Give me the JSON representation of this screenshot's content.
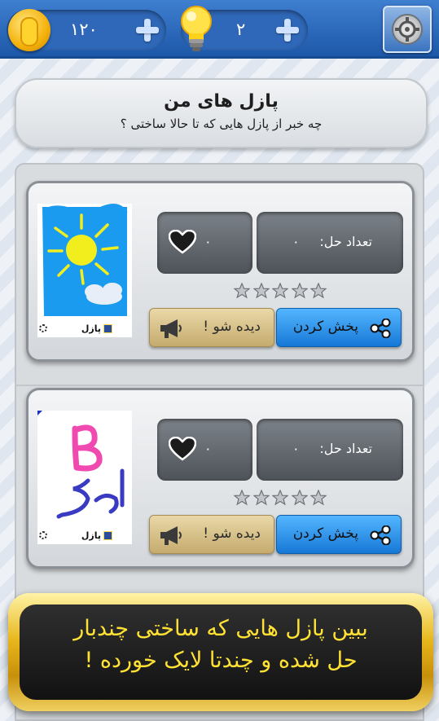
{
  "topbar": {
    "coins_value": "۱۲۰",
    "hints_value": "۲",
    "coin_icon": "gold-coin-icon",
    "hint_icon": "lightbulb-icon",
    "settings_icon": "gear-icon"
  },
  "header": {
    "title": "پازل های من",
    "subtitle": "چه خبر از پازل هایی که تا حالا ساختی ؟"
  },
  "puzzles": [
    {
      "image": "sun-and-cloud-drawing",
      "brand": "پازل",
      "solves_label": "تعداد حل:",
      "solves_count": "۰",
      "likes_count": "۰",
      "rating": 0,
      "watch_label": "دیده شو !",
      "share_label": "پخش کردن"
    },
    {
      "image": "letter-b-kar-drawing",
      "brand": "پازل",
      "solves_label": "تعداد حل:",
      "solves_count": "۰",
      "likes_count": "۰",
      "rating": 0,
      "watch_label": "دیده شو !",
      "share_label": "پخش کردن"
    }
  ],
  "hint": {
    "line1": "ببین پازل هایی که ساختی چندبار",
    "line2": "حل شده و چندتا لایک خورده !"
  },
  "colors": {
    "topbar": "#1d57a8",
    "share_button": "#1678d6",
    "watch_button": "#c5ab6e",
    "hint_text": "#ffe233"
  }
}
